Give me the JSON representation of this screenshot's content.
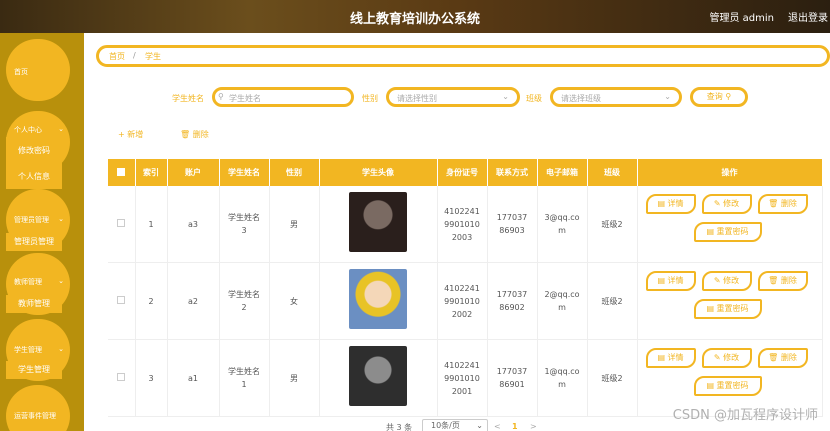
{
  "header": {
    "title": "线上教育培训办公系统",
    "user": "管理员 admin",
    "logout": "退出登录"
  },
  "sidebar": {
    "home": "首页",
    "personal_center": "个人中心",
    "change_password": "修改密码",
    "personal_info": "个人信息",
    "admin_mgmt": "管理员管理",
    "admin_mgmt_sub": "管理员管理",
    "teacher_mgmt": "教师管理",
    "teacher_mgmt_sub": "教师管理",
    "student_mgmt": "学生管理",
    "student_mgmt_sub": "学生管理",
    "events_mgmt": "运营事件管理"
  },
  "breadcrumb": {
    "home": "首页",
    "sep": "/",
    "current": "学生"
  },
  "search": {
    "name_label": "学生姓名",
    "name_placeholder": "学生姓名",
    "gender_label": "性别",
    "gender_placeholder": "请选择性别",
    "class_label": "班级",
    "class_placeholder": "请选择班级",
    "button": "查询"
  },
  "toolbar": {
    "add": "新增",
    "delete": "删除"
  },
  "table": {
    "headers": [
      "索引",
      "账户",
      "学生姓名",
      "性别",
      "学生头像",
      "身份证号",
      "联系方式",
      "电子邮箱",
      "班级",
      "操作"
    ],
    "rows": [
      {
        "index": "1",
        "account": "a3",
        "name": "学生姓名3",
        "gender": "男",
        "id_card": "410224199010102003",
        "phone": "17703786903",
        "email": "3@qq.com",
        "class": "班级2"
      },
      {
        "index": "2",
        "account": "a2",
        "name": "学生姓名2",
        "gender": "女",
        "id_card": "410224199010102002",
        "phone": "17703786902",
        "email": "2@qq.com",
        "class": "班级2"
      },
      {
        "index": "3",
        "account": "a1",
        "name": "学生姓名1",
        "gender": "男",
        "id_card": "410224199010102001",
        "phone": "17703786901",
        "email": "1@qq.com",
        "class": "班级2"
      }
    ],
    "actions": {
      "detail": "详情",
      "edit": "修改",
      "delete": "删除",
      "reset": "重置密码"
    }
  },
  "pagination": {
    "total": "共 3 条",
    "page_size": "10条/页",
    "prev": "<",
    "current": "1",
    "next": ">"
  },
  "watermark": "CSDN @加瓦程序设计师",
  "colors": {
    "accent": "#f2b622",
    "sidebar": "#b8900c"
  }
}
